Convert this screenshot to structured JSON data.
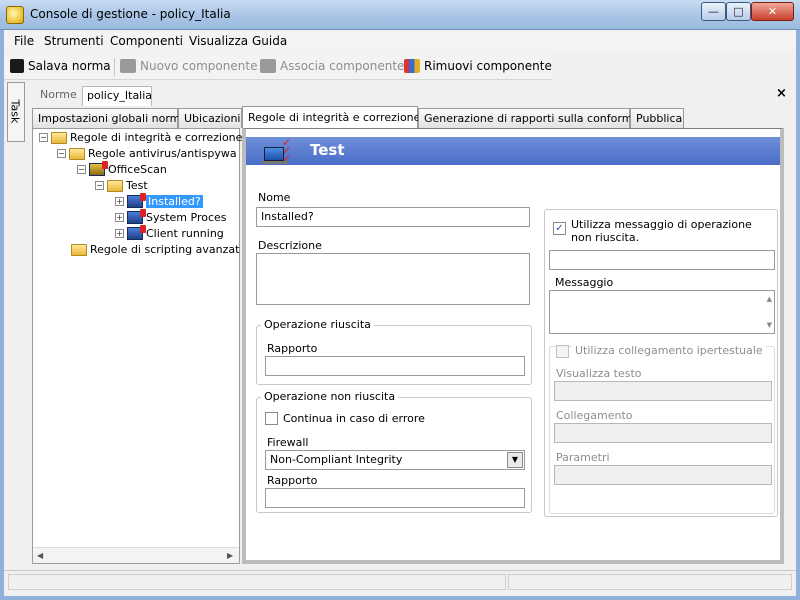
{
  "window": {
    "title": "Console di gestione  - policy_Italia",
    "min": "—",
    "max": "□",
    "close": "✕"
  },
  "menu": [
    "File",
    "Strumenti",
    "Componenti",
    "Visualizza",
    "Guida"
  ],
  "toolbar": {
    "save": "Salava norma",
    "new_component": "Nuovo componente",
    "associate": "Associa componente",
    "remove": "Rimuovi componente"
  },
  "side_tab": "Task",
  "doc_tabs": {
    "norme": "Norme",
    "policy": "policy_Italia",
    "close": "×"
  },
  "tabs": [
    "Impostazioni globali norme",
    "Ubicazioni",
    "Regole di integrità e correzione",
    "Generazione di rapporti sulla conformità",
    "Pubblica"
  ],
  "tree": {
    "root": "Regole di integrità e correzione",
    "antivirus": "Regole antivirus/antispywa",
    "officescan": "OfficeScan",
    "test": "Test",
    "installed": "Installed?",
    "system": "System Proces",
    "client": "Client running",
    "scripting": "Regole di scripting avanzat"
  },
  "detail": {
    "header": "Test",
    "name_label": "Nome",
    "name_value": "Installed?",
    "description_label": "Descrizione",
    "success_group": "Operazione riuscita",
    "success_report_label": "Rapporto",
    "fail_group": "Operazione non riuscita",
    "continue_on_error": "Continua in caso di errore",
    "firewall_label": "Firewall",
    "firewall_value": "Non-Compliant Integrity",
    "fail_report_label": "Rapporto",
    "use_fail_message": "Utilizza messaggio di operazione non riuscita.",
    "message_label": "Messaggio",
    "use_hyperlink": "Utilizza collegamento ipertestuale",
    "display_text_label": "Visualizza testo",
    "link_label": "Collegamento",
    "params_label": "Parametri"
  },
  "colors": {
    "header_blue": "#5a7bd0",
    "selection": "#3399ff"
  }
}
